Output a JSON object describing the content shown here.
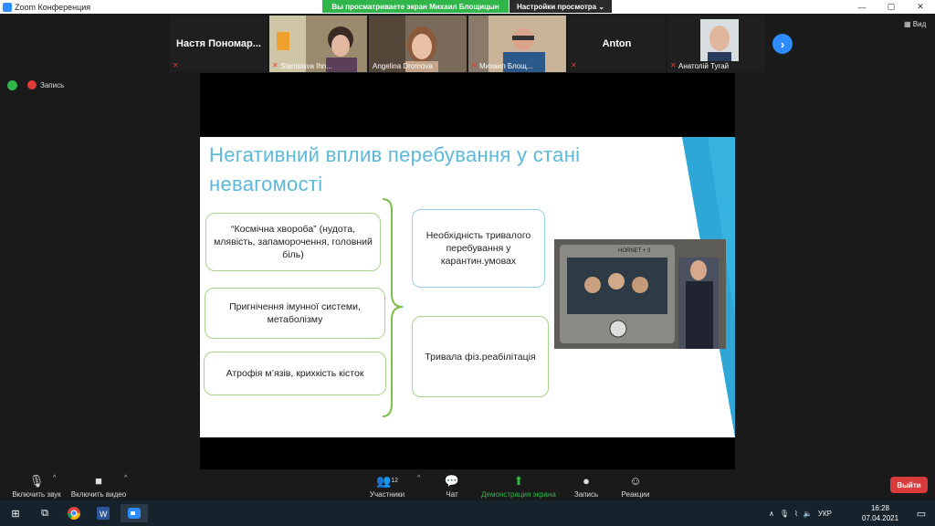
{
  "window": {
    "title": "Zoom Конференция",
    "controls": [
      "—",
      "▢",
      "✕"
    ]
  },
  "banner": {
    "sharing_text": "Вы просматриваете экран Михаил Блощицын",
    "view_settings_label": "Настройки просмотра ⌄"
  },
  "participants": [
    {
      "name": "Настя Пономар...",
      "caption": ""
    },
    {
      "name": "",
      "caption": "Stanislava Ihn..."
    },
    {
      "name": "",
      "caption": "Angelina Dromova"
    },
    {
      "name": "",
      "caption": "Михаил Блощ..."
    },
    {
      "name": "Anton",
      "caption": ""
    },
    {
      "name": "",
      "caption": "Анатолій Тугай"
    }
  ],
  "strip": {
    "view_label": "Вид",
    "next_icon": "chevron-right-icon"
  },
  "status": {
    "record_label": "Запись"
  },
  "slide": {
    "title": "Негативний вплив перебування у стані невагомості",
    "boxes": {
      "left1": "“Космічна хвороба” (нудота, млявість, запаморочення, головний біль)",
      "left2": "Пригнічення імунної системи, метаболізму",
      "left3": "Атрофія м’язів, крихкість кісток",
      "right1": "Необхідність тривалого перебування у карантин.умовах",
      "right2": "Тривала фіз.реабілітація"
    },
    "photo_plate": "HORNET + 3"
  },
  "toolbar": {
    "audio_label": "Включить звук",
    "video_label": "Включить видео",
    "participants_label": "Участники",
    "participants_count": "12",
    "chat_label": "Чат",
    "share_label": "Демонстрация экрана",
    "record_label": "Запись",
    "reactions_label": "Реакции",
    "leave_label": "Выйти"
  },
  "taskbar": {
    "lang": "УКР",
    "time": "16:28",
    "date": "07.04.2021"
  },
  "colors": {
    "share_green": "#2fb54a",
    "zoom_blue": "#2d8cff",
    "leave_red": "#d93a3a",
    "slide_title": "#5bb9d9",
    "box_green": "#a7d48a"
  }
}
